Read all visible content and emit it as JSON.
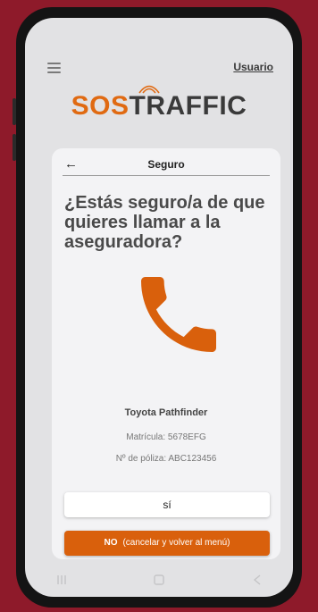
{
  "header": {
    "user_link": "Usuario",
    "logo_sos": "SOS",
    "logo_traffic": "TRAFFIC"
  },
  "card": {
    "title": "Seguro",
    "question": "¿Estás seguro/a de que quieres llamar a la aseguradora?",
    "vehicle_name": "Toyota Pathfinder",
    "plate_text": "Matrícula: 5678EFG",
    "policy_text": "Nº de póliza: ABC123456",
    "yes_label": "sí",
    "no_label_bold": "NO",
    "no_label_rest": "(cancelar y volver al menú)"
  },
  "colors": {
    "accent": "#d9600c",
    "background": "#8e1a2a",
    "screen": "#e2e2e4"
  },
  "icons": {
    "menu": "hamburger-menu-icon",
    "back": "back-arrow-icon",
    "call": "phone-handset-icon",
    "nav": [
      "recent-apps-icon",
      "home-icon",
      "back-nav-icon"
    ]
  }
}
